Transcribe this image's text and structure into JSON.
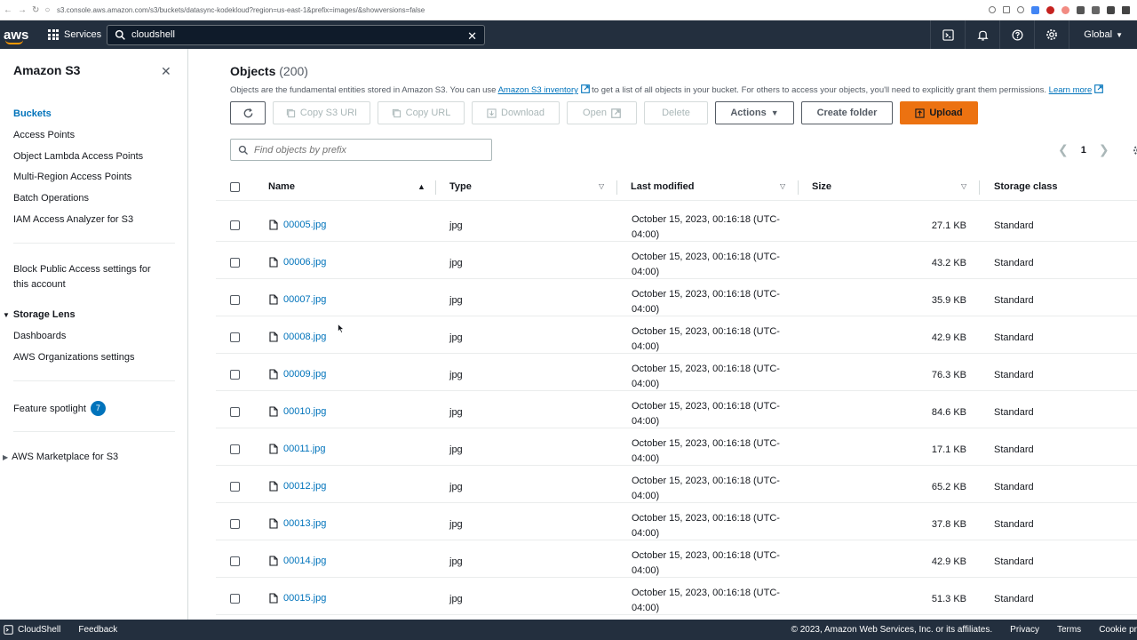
{
  "browser": {
    "url": "s3.console.aws.amazon.com/s3/buckets/datasync-kodekloud?region=us-east-1&prefix=images/&showversions=false"
  },
  "topnav": {
    "logo": "aws",
    "services_label": "Services",
    "search_value": "cloudshell",
    "region_label": "Global"
  },
  "sidebar": {
    "title": "Amazon S3",
    "items": [
      {
        "label": "Buckets"
      },
      {
        "label": "Access Points"
      },
      {
        "label": "Object Lambda Access Points"
      },
      {
        "label": "Multi-Region Access Points"
      },
      {
        "label": "Batch Operations"
      },
      {
        "label": "IAM Access Analyzer for S3"
      },
      {
        "label": "Block Public Access settings for"
      },
      {
        "label": "this account"
      },
      {
        "label": "Dashboards"
      },
      {
        "label": "AWS Organizations settings"
      },
      {
        "label": "Feature spotlight"
      }
    ],
    "storage_lens": "Storage Lens",
    "feature_badge": "7",
    "marketplace": "AWS Marketplace for S3"
  },
  "objects": {
    "title": "Objects",
    "count": "(200)",
    "desc_pre": "Objects are the fundamental entities stored in Amazon S3. You can use ",
    "desc_link": "Amazon S3 inventory",
    "desc_post": " to get a list of all objects in your bucket. For others to access your objects, you'll need to explicitly grant them permissions. ",
    "learn_more": "Learn more"
  },
  "toolbar": {
    "copy_s3_uri": "Copy S3 URI",
    "copy_url": "Copy URL",
    "download": "Download",
    "open": "Open",
    "delete": "Delete",
    "actions": "Actions",
    "create_folder": "Create folder",
    "upload": "Upload"
  },
  "search": {
    "placeholder": "Find objects by prefix"
  },
  "pager": {
    "page": "1"
  },
  "table": {
    "headers": {
      "name": "Name",
      "type": "Type",
      "last_modified": "Last modified",
      "size": "Size",
      "storage_class": "Storage class"
    },
    "rows": [
      {
        "name": "00005.jpg",
        "type": "jpg",
        "mod1": "October 15, 2023, 00:16:18 (UTC-",
        "mod2": "04:00)",
        "size": "27.1 KB",
        "cls": "Standard"
      },
      {
        "name": "00006.jpg",
        "type": "jpg",
        "mod1": "October 15, 2023, 00:16:18 (UTC-",
        "mod2": "04:00)",
        "size": "43.2 KB",
        "cls": "Standard"
      },
      {
        "name": "00007.jpg",
        "type": "jpg",
        "mod1": "October 15, 2023, 00:16:18 (UTC-",
        "mod2": "04:00)",
        "size": "35.9 KB",
        "cls": "Standard"
      },
      {
        "name": "00008.jpg",
        "type": "jpg",
        "mod1": "October 15, 2023, 00:16:18 (UTC-",
        "mod2": "04:00)",
        "size": "42.9 KB",
        "cls": "Standard"
      },
      {
        "name": "00009.jpg",
        "type": "jpg",
        "mod1": "October 15, 2023, 00:16:18 (UTC-",
        "mod2": "04:00)",
        "size": "76.3 KB",
        "cls": "Standard"
      },
      {
        "name": "00010.jpg",
        "type": "jpg",
        "mod1": "October 15, 2023, 00:16:18 (UTC-",
        "mod2": "04:00)",
        "size": "84.6 KB",
        "cls": "Standard"
      },
      {
        "name": "00011.jpg",
        "type": "jpg",
        "mod1": "October 15, 2023, 00:16:18 (UTC-",
        "mod2": "04:00)",
        "size": "17.1 KB",
        "cls": "Standard"
      },
      {
        "name": "00012.jpg",
        "type": "jpg",
        "mod1": "October 15, 2023, 00:16:18 (UTC-",
        "mod2": "04:00)",
        "size": "65.2 KB",
        "cls": "Standard"
      },
      {
        "name": "00013.jpg",
        "type": "jpg",
        "mod1": "October 15, 2023, 00:16:18 (UTC-",
        "mod2": "04:00)",
        "size": "37.8 KB",
        "cls": "Standard"
      },
      {
        "name": "00014.jpg",
        "type": "jpg",
        "mod1": "October 15, 2023, 00:16:18 (UTC-",
        "mod2": "04:00)",
        "size": "42.9 KB",
        "cls": "Standard"
      },
      {
        "name": "00015.jpg",
        "type": "jpg",
        "mod1": "October 15, 2023, 00:16:18 (UTC-",
        "mod2": "04:00)",
        "size": "51.3 KB",
        "cls": "Standard"
      }
    ]
  },
  "footer": {
    "cloudshell": "CloudShell",
    "feedback": "Feedback",
    "copyright": "© 2023, Amazon Web Services, Inc. or its affiliates.",
    "privacy": "Privacy",
    "terms": "Terms",
    "cookie": "Cookie pr"
  },
  "colors": {
    "nav_bg": "#232f3e",
    "link": "#0073bb",
    "primary": "#ec7211"
  }
}
